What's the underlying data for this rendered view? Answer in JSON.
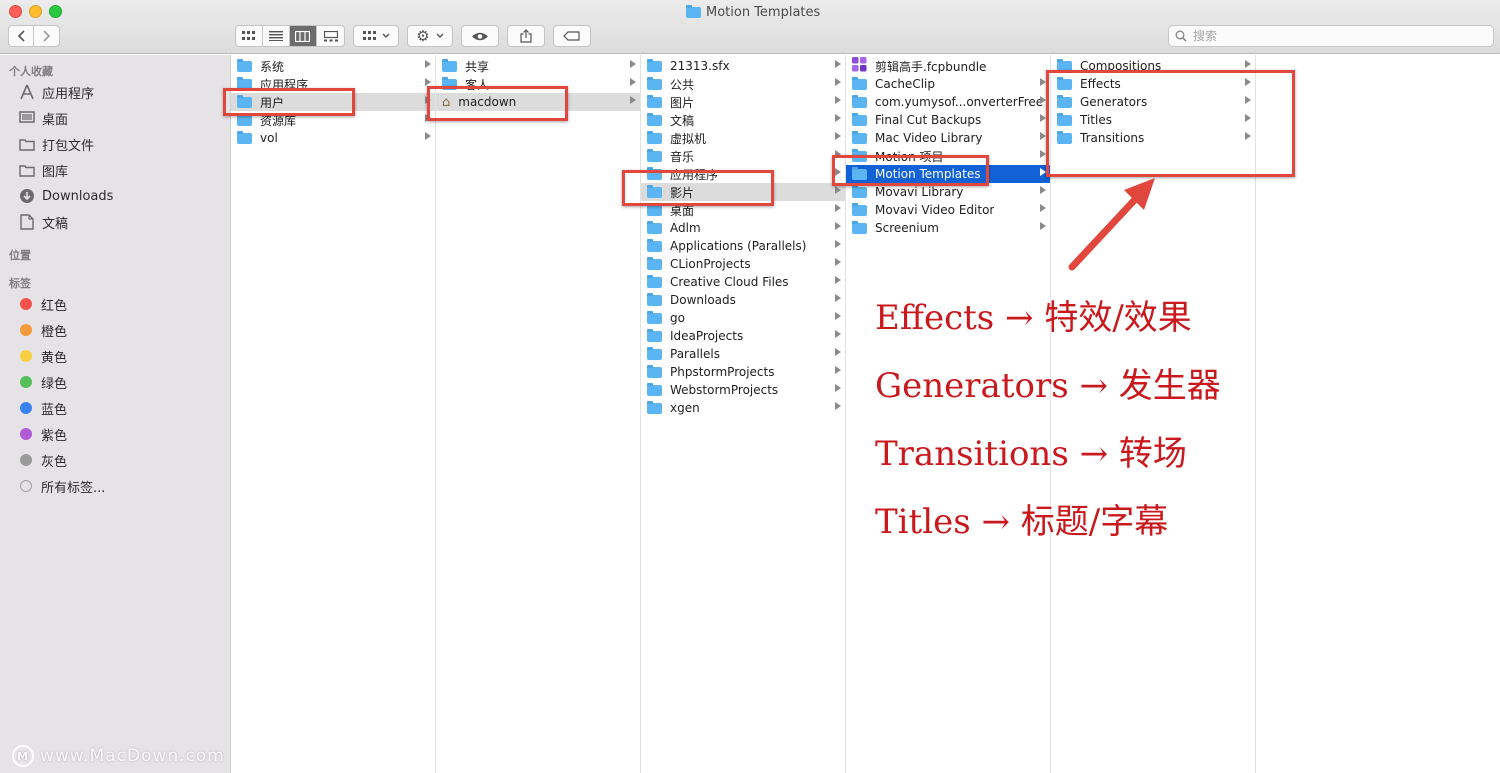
{
  "window": {
    "title": "Motion Templates"
  },
  "toolbar": {
    "back_icon": "chevron-left",
    "forward_icon": "chevron-right",
    "view_icons": [
      "grid",
      "list",
      "columns",
      "gallery"
    ],
    "group_icon": "grid-dropdown",
    "action_icon": "gear-dropdown",
    "quicklook_icon": "eye",
    "share_icon": "share",
    "tag_icon": "tag",
    "search_placeholder": "搜索"
  },
  "sidebar": {
    "favorites_header": "个人收藏",
    "favorites": [
      {
        "label": "应用程序",
        "icon": "applications-icon"
      },
      {
        "label": "桌面",
        "icon": "desktop-icon"
      },
      {
        "label": "打包文件",
        "icon": "folder-icon"
      },
      {
        "label": "图库",
        "icon": "folder-icon"
      },
      {
        "label": "Downloads",
        "icon": "downloads-icon"
      },
      {
        "label": "文稿",
        "icon": "documents-icon"
      }
    ],
    "locations_header": "位置",
    "tags_header": "标签",
    "tags": [
      {
        "label": "红色",
        "color": "#f2524a"
      },
      {
        "label": "橙色",
        "color": "#f5993a"
      },
      {
        "label": "黄色",
        "color": "#f6cf45"
      },
      {
        "label": "绿色",
        "color": "#55c05a"
      },
      {
        "label": "蓝色",
        "color": "#3a82f0"
      },
      {
        "label": "紫色",
        "color": "#b15ad6"
      },
      {
        "label": "灰色",
        "color": "#9a9a9a"
      },
      {
        "label": "所有标签...",
        "color": "#c8c8c8"
      }
    ],
    "watermark": "www.MacDown.com"
  },
  "columns": {
    "col1": [
      {
        "label": "系统",
        "chev": true
      },
      {
        "label": "应用程序",
        "chev": true
      },
      {
        "label": "用户",
        "chev": true,
        "selected": "grey"
      },
      {
        "label": "资源库",
        "chev": true
      },
      {
        "label": "vol",
        "chev": true
      }
    ],
    "col2": [
      {
        "label": "共享",
        "chev": true
      },
      {
        "label": "客人",
        "chev": true
      },
      {
        "label": "macdown",
        "chev": true,
        "selected": "grey",
        "icon": "home"
      }
    ],
    "col3": [
      {
        "label": "21313.sfx",
        "chev": true
      },
      {
        "label": "公共",
        "chev": true
      },
      {
        "label": "图片",
        "chev": true
      },
      {
        "label": "文稿",
        "chev": true
      },
      {
        "label": "虚拟机",
        "chev": true
      },
      {
        "label": "音乐",
        "chev": true
      },
      {
        "label": "应用程序",
        "chev": true
      },
      {
        "label": "影片",
        "chev": true,
        "selected": "grey"
      },
      {
        "label": "桌面",
        "chev": true
      },
      {
        "label": "Adlm",
        "chev": true
      },
      {
        "label": "Applications (Parallels)",
        "chev": true
      },
      {
        "label": "CLionProjects",
        "chev": true
      },
      {
        "label": "Creative Cloud Files",
        "chev": true
      },
      {
        "label": "Downloads",
        "chev": true
      },
      {
        "label": "go",
        "chev": true
      },
      {
        "label": "IdeaProjects",
        "chev": true
      },
      {
        "label": "Parallels",
        "chev": true
      },
      {
        "label": "PhpstormProjects",
        "chev": true
      },
      {
        "label": "WebstormProjects",
        "chev": true
      },
      {
        "label": "xgen",
        "chev": true
      }
    ],
    "col4": [
      {
        "label": "剪辑高手.fcpbundle",
        "chev": false,
        "icon": "fcp"
      },
      {
        "label": "CacheClip",
        "chev": true
      },
      {
        "label": "com.yumysof...onverterFree",
        "chev": true
      },
      {
        "label": "Final Cut Backups",
        "chev": true
      },
      {
        "label": "Mac Video Library",
        "chev": true
      },
      {
        "label": "Motion 项目",
        "chev": true
      },
      {
        "label": "Motion Templates",
        "chev": true,
        "selected": "blue"
      },
      {
        "label": "Movavi Library",
        "chev": true
      },
      {
        "label": "Movavi Video Editor",
        "chev": true
      },
      {
        "label": "Screenium",
        "chev": true
      }
    ],
    "col5": [
      {
        "label": "Compositions",
        "chev": true
      },
      {
        "label": "Effects",
        "chev": true
      },
      {
        "label": "Generators",
        "chev": true
      },
      {
        "label": "Titles",
        "chev": true
      },
      {
        "label": "Transitions",
        "chev": true
      }
    ]
  },
  "annotations": [
    "Effects → 特效/效果",
    "Generators → 发生器",
    "Transitions → 转场",
    "Titles → 标题/字幕"
  ]
}
